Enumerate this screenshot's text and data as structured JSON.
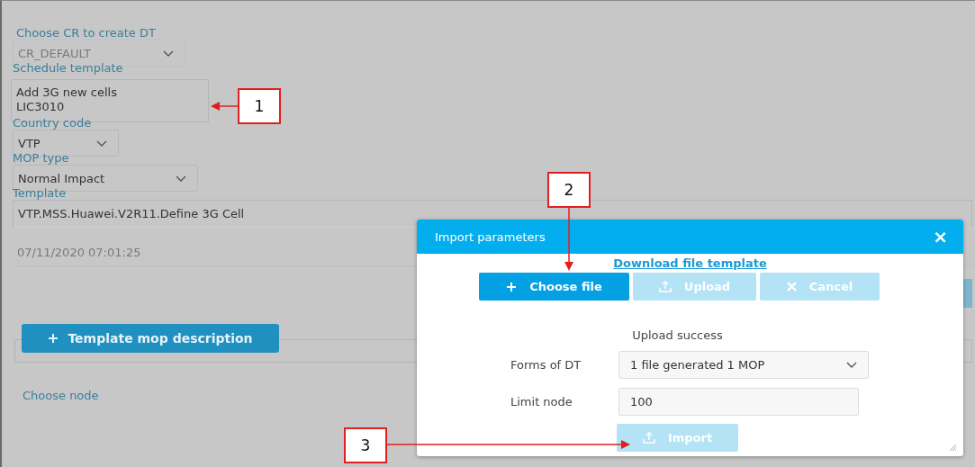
{
  "form": {
    "fields": [
      {
        "kind": "select",
        "label": "Choose CR to create DT",
        "value": "CR_DEFAULT",
        "disabled": true
      },
      {
        "kind": "textarea",
        "label": "Schedule template",
        "lines": [
          "Add 3G new cells",
          "LIC3010"
        ]
      },
      {
        "kind": "select",
        "label": "Country code",
        "value": "VTP",
        "disabled": false
      },
      {
        "kind": "select",
        "label": "MOP type",
        "value": "Normal Impact",
        "disabled": false
      },
      {
        "kind": "input",
        "label": "Template",
        "value": "VTP.MSS.Huawei.V2R11.Define 3G Cell",
        "disabled": false
      },
      {
        "kind": "input",
        "value": "07/11/2020 07:01:25",
        "disabled": true
      }
    ],
    "add_button": "Template mop description",
    "choose_node": "Choose node"
  },
  "dialog": {
    "title": "Import parameters",
    "close": "×",
    "download_link": "Download file template",
    "buttons": [
      {
        "label": "Choose file",
        "disabled": false
      },
      {
        "label": "Upload",
        "disabled": true
      },
      {
        "label": "Cancel",
        "disabled": true
      }
    ],
    "status": "Upload success",
    "forms_label": "Forms of DT",
    "forms_value": "1 file generated 1 MOP",
    "limit_label": "Limit node",
    "limit_value": "100",
    "import_button": {
      "label": "Import",
      "disabled": true
    }
  },
  "callouts": [
    "1",
    "2",
    "3"
  ]
}
